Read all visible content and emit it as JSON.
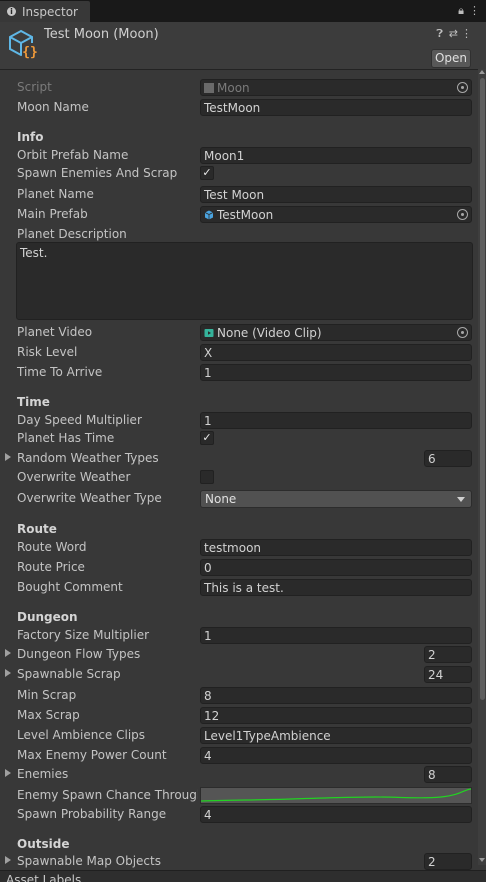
{
  "tab": {
    "title": "Inspector"
  },
  "header": {
    "object_title": "Test Moon (Moon)",
    "open_label": "Open"
  },
  "script": {
    "label": "Script",
    "value": "Moon"
  },
  "moon_name": {
    "label": "Moon Name",
    "value": "TestMoon"
  },
  "info": {
    "title": "Info",
    "orbit_prefab_name": {
      "label": "Orbit Prefab Name",
      "value": "Moon1"
    },
    "spawn_enemies": {
      "label": "Spawn Enemies And Scrap",
      "checked": true
    },
    "planet_name": {
      "label": "Planet Name",
      "value": "Test Moon"
    },
    "main_prefab": {
      "label": "Main Prefab",
      "value": "TestMoon"
    },
    "planet_description": {
      "label": "Planet Description",
      "value": "Test."
    },
    "planet_video": {
      "label": "Planet Video",
      "value": "None (Video Clip)"
    },
    "risk_level": {
      "label": "Risk Level",
      "value": "X"
    },
    "time_to_arrive": {
      "label": "Time To Arrive",
      "value": "1"
    }
  },
  "time": {
    "title": "Time",
    "day_speed": {
      "label": "Day Speed Multiplier",
      "value": "1"
    },
    "planet_has_time": {
      "label": "Planet Has Time",
      "checked": true
    },
    "random_weather": {
      "label": "Random Weather Types",
      "value": "6"
    },
    "overwrite_weather": {
      "label": "Overwrite Weather",
      "checked": false
    },
    "overwrite_weather_type": {
      "label": "Overwrite Weather Type",
      "value": "None"
    }
  },
  "route": {
    "title": "Route",
    "route_word": {
      "label": "Route Word",
      "value": "testmoon"
    },
    "route_price": {
      "label": "Route Price",
      "value": "0"
    },
    "bought_comment": {
      "label": "Bought Comment",
      "value": "This is a test."
    }
  },
  "dungeon": {
    "title": "Dungeon",
    "factory_size": {
      "label": "Factory Size Multiplier",
      "value": "1"
    },
    "dungeon_flow": {
      "label": "Dungeon Flow Types",
      "value": "2"
    },
    "spawnable_scrap": {
      "label": "Spawnable Scrap",
      "value": "24"
    },
    "min_scrap": {
      "label": "Min Scrap",
      "value": "8"
    },
    "max_scrap": {
      "label": "Max Scrap",
      "value": "12"
    },
    "ambience": {
      "label": "Level Ambience Clips",
      "value": "Level1TypeAmbience"
    },
    "max_enemy_power": {
      "label": "Max Enemy Power Count",
      "value": "4"
    },
    "enemies": {
      "label": "Enemies",
      "value": "8"
    },
    "enemy_spawn_chance": {
      "label": "Enemy Spawn Chance Throughout Day"
    },
    "spawn_probability": {
      "label": "Spawn Probability Range",
      "value": "4"
    }
  },
  "outside": {
    "title": "Outside",
    "spawnable_map_objects": {
      "label": "Spawnable Map Objects",
      "value": "2"
    }
  },
  "footer": {
    "asset_labels": "Asset Labels"
  },
  "colors": {
    "curve": "#22d322",
    "panel": "#383838",
    "field": "#2a2a2a"
  }
}
